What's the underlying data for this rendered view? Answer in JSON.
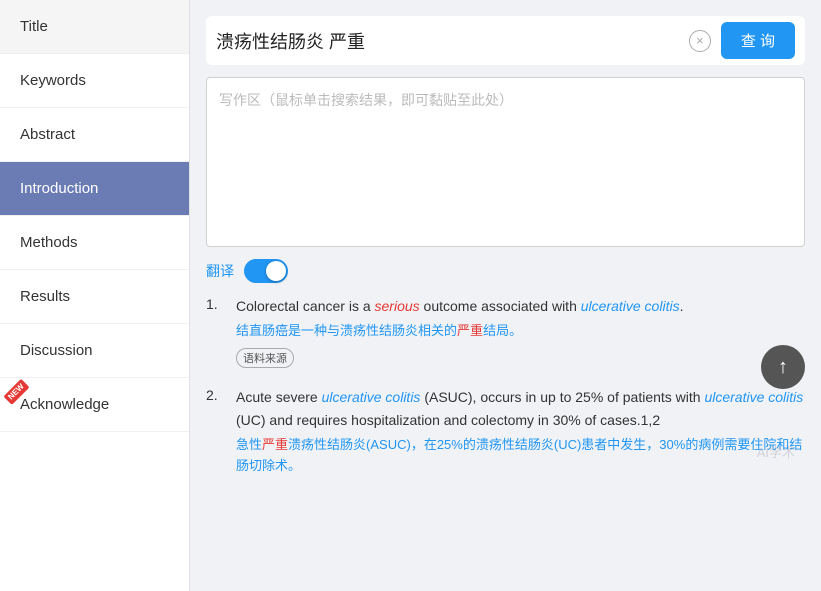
{
  "sidebar": {
    "items": [
      {
        "label": "Title",
        "active": false,
        "new": false
      },
      {
        "label": "Keywords",
        "active": false,
        "new": false
      },
      {
        "label": "Abstract",
        "active": false,
        "new": false
      },
      {
        "label": "Introduction",
        "active": true,
        "new": false
      },
      {
        "label": "Methods",
        "active": false,
        "new": false
      },
      {
        "label": "Results",
        "active": false,
        "new": false
      },
      {
        "label": "Discussion",
        "active": false,
        "new": false
      },
      {
        "label": "Acknowledge",
        "active": false,
        "new": true
      }
    ]
  },
  "search": {
    "query": "溃疡性结肠炎 严重",
    "clear_label": "×",
    "button_label": "查 询"
  },
  "writing_area": {
    "placeholder": "写作区（鼠标单击搜索结果，即可黏贴至此处）"
  },
  "translate": {
    "label": "翻译"
  },
  "results": [
    {
      "num": "1.",
      "en_parts": [
        {
          "text": "Colorectal cancer is a ",
          "style": "normal"
        },
        {
          "text": "serious",
          "style": "italic-red"
        },
        {
          "text": " outcome associated with ",
          "style": "normal"
        },
        {
          "text": "ulcerative colitis",
          "style": "italic-blue"
        },
        {
          "text": ".",
          "style": "normal"
        }
      ],
      "cn": "结直肠癌是一种与溃疡性结肠炎相关的严重结局。",
      "cn_highlights": [
        "溃疡性结肠炎",
        "严重"
      ],
      "source": "语料来源"
    },
    {
      "num": "2.",
      "en_parts": [
        {
          "text": "Acute severe ",
          "style": "normal"
        },
        {
          "text": "ulcerative colitis",
          "style": "italic-blue"
        },
        {
          "text": " (ASUC), occurs in up to 25% of patients with ",
          "style": "normal"
        },
        {
          "text": "ulcerative colitis",
          "style": "italic-blue"
        },
        {
          "text": " (UC) and requires hospitalization and colectomy in 30% of cases.1,2",
          "style": "normal"
        }
      ],
      "cn": "急性严重溃疡性结肠炎(ASUC)，在25%的溃疡性结肠炎(UC)患者中发生，30%的病例需要住院和结肠切除术。",
      "cn_highlights": [
        "严重溃疡性结肠炎",
        "溃疡性结肠炎",
        "结肠"
      ]
    }
  ],
  "watermark": "AI学术"
}
